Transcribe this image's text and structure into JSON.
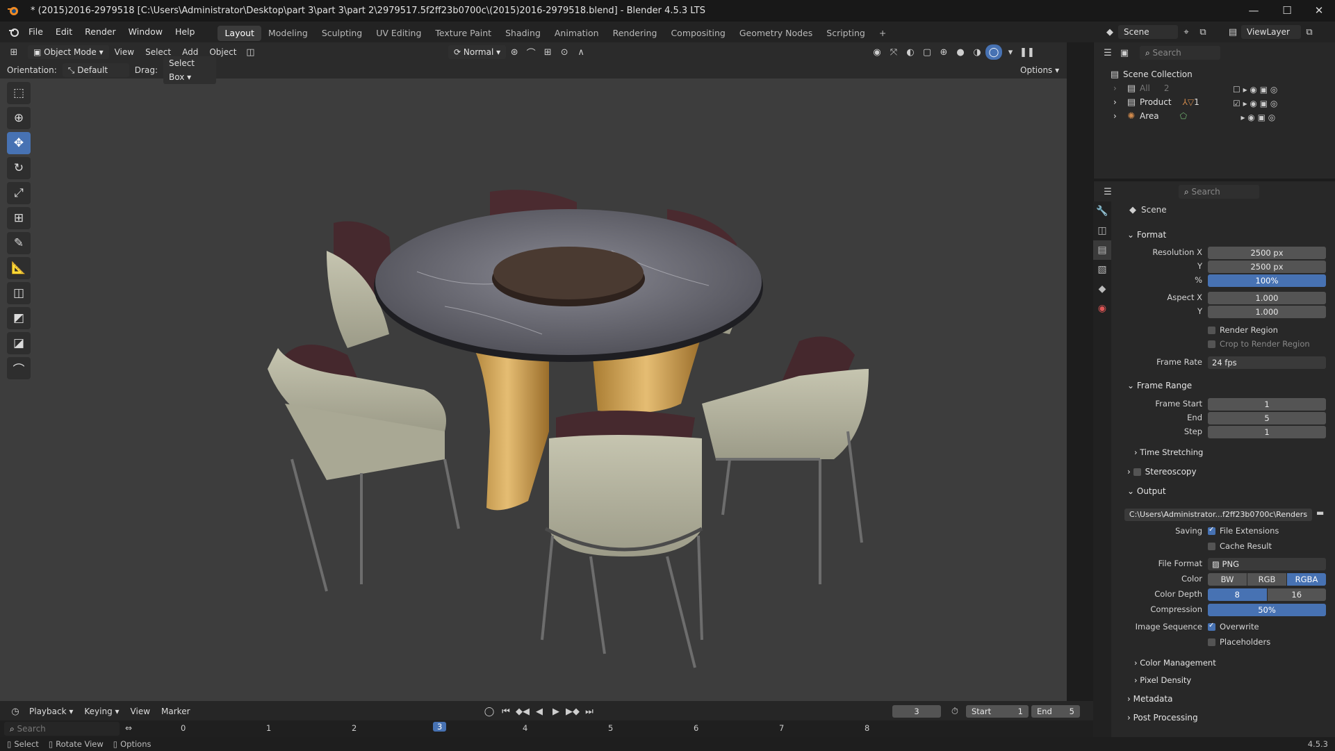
{
  "window": {
    "title": "* (2015)2016-2979518 [C:\\Users\\Administrator\\Desktop\\part 3\\part 3\\part 2\\2979517.5f2ff23b0700c\\(2015)2016-2979518.blend] - Blender 4.5.3 LTS",
    "controls": {
      "minimize": "—",
      "maximize": "☐",
      "close": "✕"
    }
  },
  "menu": {
    "items": [
      "File",
      "Edit",
      "Render",
      "Window",
      "Help"
    ],
    "workspaces": [
      "Layout",
      "Modeling",
      "Sculpting",
      "UV Editing",
      "Texture Paint",
      "Shading",
      "Animation",
      "Rendering",
      "Compositing",
      "Geometry Nodes",
      "Scripting"
    ],
    "add_tab": "+",
    "scene": "Scene",
    "view_layer": "ViewLayer"
  },
  "viewport_header": {
    "mode": "Object Mode",
    "menus": [
      "View",
      "Select",
      "Add",
      "Object"
    ],
    "transform": "Normal",
    "orientation_label": "Orientation:",
    "orientation_value": "Default",
    "drag_label": "Drag:",
    "drag_value": "Select Box",
    "options": "Options"
  },
  "toolbar": {
    "tools": [
      "select-box-icon",
      "cursor-icon",
      "move-icon",
      "rotate-icon",
      "scale-icon",
      "transform-icon",
      "annotate-icon",
      "measure-icon",
      "add-cube-icon",
      "shear-icon",
      "shear-alt-icon",
      "bend-icon"
    ]
  },
  "outliner": {
    "search_placeholder": "Search",
    "root": "Scene Collection",
    "rows": [
      {
        "label": "All",
        "count": "2"
      },
      {
        "label": "Product",
        "count": "1"
      },
      {
        "label": "Area",
        "count": ""
      }
    ]
  },
  "properties": {
    "search_placeholder": "Search",
    "context": "Scene",
    "format": {
      "header": "Format",
      "resolution_x_label": "Resolution X",
      "resolution_x": "2500 px",
      "resolution_y_label": "Y",
      "resolution_y": "2500 px",
      "percent_label": "%",
      "percent": "100%",
      "aspect_x_label": "Aspect X",
      "aspect_x": "1.000",
      "aspect_y_label": "Y",
      "aspect_y": "1.000",
      "render_region": "Render Region",
      "crop": "Crop to Render Region",
      "frame_rate_label": "Frame Rate",
      "frame_rate": "24 fps"
    },
    "frame_range": {
      "header": "Frame Range",
      "start_label": "Frame Start",
      "start": "1",
      "end_label": "End",
      "end": "5",
      "step_label": "Step",
      "step": "1",
      "time_stretching": "Time Stretching"
    },
    "stereoscopy": "Stereoscopy",
    "output": {
      "header": "Output",
      "path": "C:\\Users\\Administrator...f2ff23b0700c\\Renders",
      "saving_label": "Saving",
      "file_extensions": "File Extensions",
      "cache_result": "Cache Result",
      "file_format_label": "File Format",
      "file_format": "PNG",
      "color_label": "Color",
      "color_options": [
        "BW",
        "RGB",
        "RGBA"
      ],
      "color_depth_label": "Color Depth",
      "depth_options": [
        "8",
        "16"
      ],
      "compression_label": "Compression",
      "compression": "50%",
      "image_sequence_label": "Image Sequence",
      "overwrite": "Overwrite",
      "placeholders": "Placeholders",
      "color_management": "Color Management",
      "pixel_density": "Pixel Density"
    },
    "metadata": "Metadata",
    "post_processing": "Post Processing"
  },
  "timeline": {
    "menus": [
      "Playback",
      "Keying",
      "View",
      "Marker"
    ],
    "current_frame": "3",
    "start_label": "Start",
    "start": "1",
    "end_label": "End",
    "end": "5",
    "search_placeholder": "Search",
    "ruler": [
      "0",
      "1",
      "2",
      "3",
      "4",
      "5",
      "6",
      "7",
      "8"
    ]
  },
  "status": {
    "select": "Select",
    "rotate": "Rotate View",
    "options": "Options",
    "version": "4.5.3"
  },
  "colors": {
    "accent": "#4772b3",
    "panel": "#282828",
    "viewport": "#3d3d3d"
  }
}
